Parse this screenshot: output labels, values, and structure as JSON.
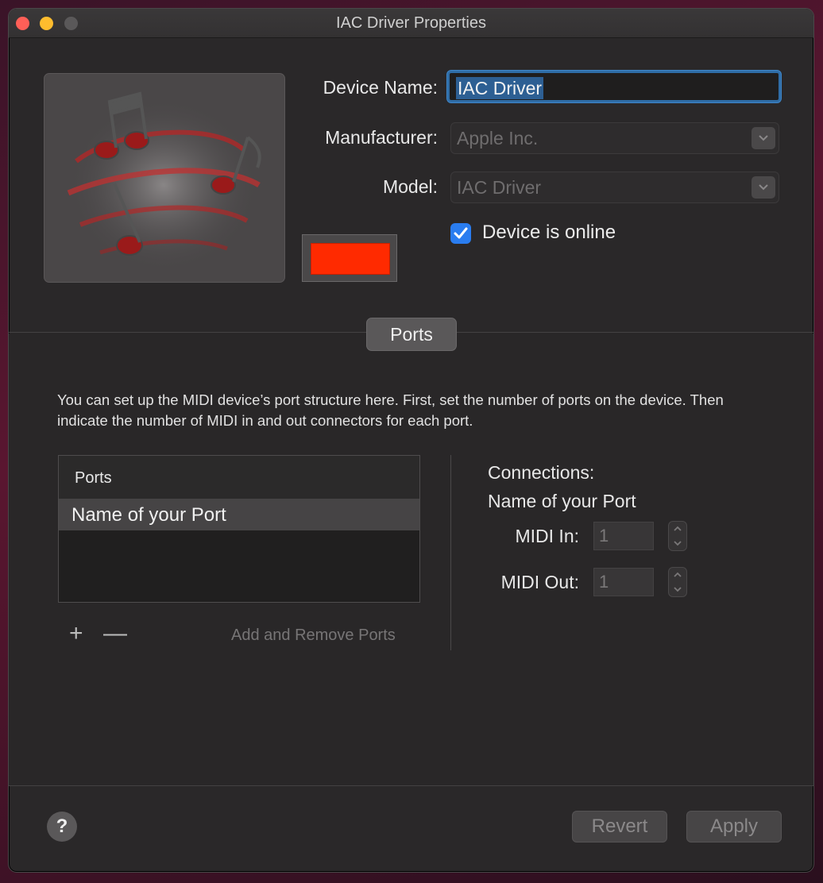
{
  "window": {
    "title": "IAC Driver Properties"
  },
  "device": {
    "name_label": "Device Name:",
    "name_value": "IAC Driver",
    "manufacturer_label": "Manufacturer:",
    "manufacturer_value": "Apple Inc.",
    "model_label": "Model:",
    "model_value": "IAC Driver",
    "online_label": "Device is online",
    "online_checked": true,
    "icon": "midi-notes-icon",
    "color": "#ff2a00"
  },
  "tabs": {
    "ports_label": "Ports"
  },
  "ports": {
    "description": "You can set up the MIDI device’s port structure here. First, set the number of ports on the device. Then indicate the number of MIDI in and out connectors for each port.",
    "table_header": "Ports",
    "rows": [
      "Name of your Port"
    ],
    "add_symbol": "+",
    "remove_symbol": "—",
    "add_remove_label": "Add and Remove Ports"
  },
  "connections": {
    "title": "Connections:",
    "port_name": "Name of your Port",
    "midi_in_label": "MIDI In:",
    "midi_in_value": "1",
    "midi_out_label": "MIDI Out:",
    "midi_out_value": "1"
  },
  "footer": {
    "help_symbol": "?",
    "revert_label": "Revert",
    "apply_label": "Apply"
  },
  "colors": {
    "accent": "#2a7df0",
    "selection": "#2d5f93",
    "window_bg": "#2a2829"
  }
}
